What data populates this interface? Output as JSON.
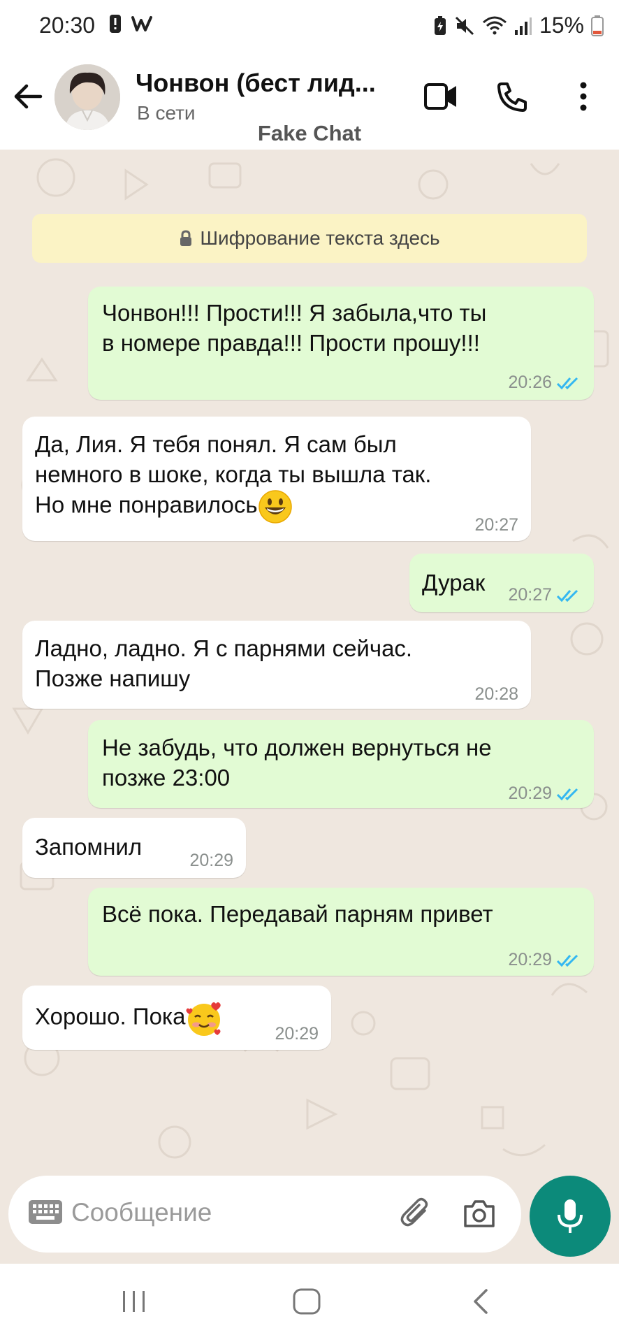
{
  "status_bar": {
    "time": "20:30",
    "battery": "15%",
    "icons": [
      "alert-icon",
      "webtoon-icon",
      "battery-saver-icon",
      "mute-icon",
      "wifi-icon",
      "signal-icon",
      "battery-icon"
    ]
  },
  "header": {
    "contact_name": "Чонвон (бест лид...",
    "status": "В сети",
    "watermark": "Fake Chat",
    "icons": [
      "back-arrow-icon",
      "video-call-icon",
      "phone-icon",
      "more-vertical-icon"
    ]
  },
  "encryption_notice": "Шифрование текста здесь",
  "messages": [
    {
      "direction": "out",
      "lines": [
        "Чонвон!!! Прости!!! Я забыла,что ты",
        "в номере правда!!! Прости прошу!!!"
      ],
      "time": "20:26",
      "read": true
    },
    {
      "direction": "in",
      "lines": [
        "Да, Лия. Я тебя понял. Я сам был",
        "немного в шоке, когда ты вышла так.",
        "Но мне понравилось"
      ],
      "emoji": "grinning-face",
      "time": "20:27"
    },
    {
      "direction": "out",
      "lines": [
        "Дурак"
      ],
      "time": "20:27",
      "read": true
    },
    {
      "direction": "in",
      "lines": [
        "Ладно, ладно. Я с парнями сейчас.",
        "Позже напишу"
      ],
      "time": "20:28"
    },
    {
      "direction": "out",
      "lines": [
        "Не забудь, что должен вернуться не",
        "позже 23:00"
      ],
      "time": "20:29",
      "read": true
    },
    {
      "direction": "in",
      "lines": [
        "Запомнил"
      ],
      "time": "20:29"
    },
    {
      "direction": "out",
      "lines": [
        "Всё пока. Передавай парням привет"
      ],
      "time": "20:29",
      "read": true
    },
    {
      "direction": "in",
      "lines": [
        "Хорошо. Пока"
      ],
      "emoji": "smiling-face-with-hearts",
      "time": "20:29"
    }
  ],
  "input": {
    "placeholder": "Сообщение",
    "icons": [
      "keyboard-icon",
      "attach-icon",
      "camera-icon",
      "mic-icon"
    ]
  },
  "colors": {
    "outgoing_bubble": "#e2fbd4",
    "incoming_bubble": "#ffffff",
    "chat_background": "#efe7df",
    "accent": "#0c8a7a",
    "read_ticks": "#34b7f1"
  }
}
